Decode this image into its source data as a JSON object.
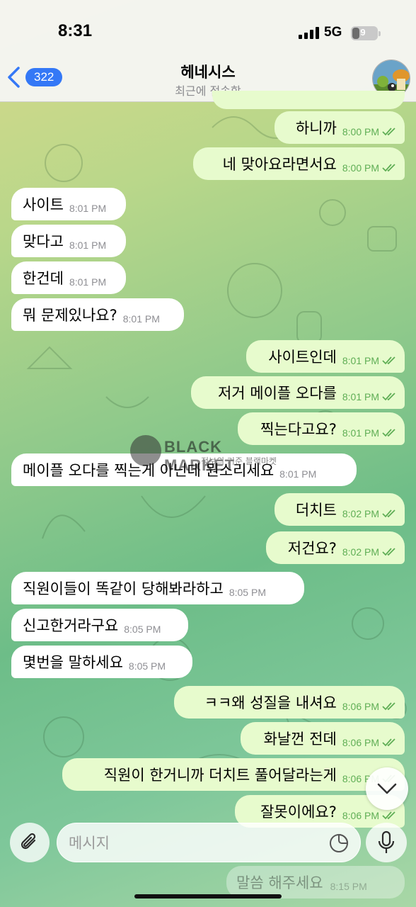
{
  "status_bar": {
    "time": "8:31",
    "network": "5G",
    "battery": "9"
  },
  "header": {
    "back_count": "322",
    "title": "헤네시스",
    "subtitle": "최근에 접속함"
  },
  "messages": [
    {
      "dir": "out",
      "text": "하니까",
      "time": "8:00 PM"
    },
    {
      "dir": "out",
      "text": "네 맞아요라면서요",
      "time": "8:00 PM"
    },
    {
      "dir": "in",
      "text": "사이트",
      "time": "8:01 PM"
    },
    {
      "dir": "in",
      "text": "맞다고",
      "time": "8:01 PM"
    },
    {
      "dir": "in",
      "text": "한건데",
      "time": "8:01 PM"
    },
    {
      "dir": "in",
      "text": "뭐 문제있나요?",
      "time": "8:01 PM"
    },
    {
      "dir": "out",
      "text": "사이트인데",
      "time": "8:01 PM"
    },
    {
      "dir": "out",
      "text": "저거 메이플 오다를",
      "time": "8:01 PM"
    },
    {
      "dir": "out",
      "text": "찍는다고요?",
      "time": "8:01 PM"
    },
    {
      "dir": "in",
      "text": "메이플 오다를 찍는게 아닌데 뭔소리세요",
      "time": "8:01 PM"
    },
    {
      "dir": "out",
      "text": "더치트",
      "time": "8:02 PM"
    },
    {
      "dir": "out",
      "text": "저건요?",
      "time": "8:02 PM"
    },
    {
      "dir": "in",
      "text": "직원이들이 똑같이 당해봐라하고",
      "time": "8:05 PM"
    },
    {
      "dir": "in",
      "text": "신고한거라구요",
      "time": "8:05 PM"
    },
    {
      "dir": "in",
      "text": "몇번을 말하세요",
      "time": "8:05 PM"
    },
    {
      "dir": "out",
      "text": "ㅋㅋ왜 성질을 내셔요",
      "time": "8:06 PM"
    },
    {
      "dir": "out",
      "text": "화날껀 전데",
      "time": "8:06 PM"
    },
    {
      "dir": "out",
      "text": "직원이 한거니까 더치트 풀어달라는게",
      "time": "8:06 PM"
    },
    {
      "dir": "out",
      "text": "잘못이에요?",
      "time": "8:06 PM"
    }
  ],
  "ghost_message": {
    "text": "말씀 해주세요",
    "time": "8:15 PM"
  },
  "watermark": {
    "text": "BLACK MARKET",
    "sub": "정보의 기준 블랙마켓"
  },
  "composer": {
    "placeholder": "메시지"
  },
  "colors": {
    "accent": "#3478f6",
    "outgoing_bubble": "#e7fbcd",
    "incoming_bubble": "#ffffff",
    "check_green": "#5fae55"
  },
  "icons": [
    "back-chevron-icon",
    "paperclip-icon",
    "sticker-icon",
    "microphone-icon",
    "chevron-down-icon",
    "double-check-icon"
  ]
}
